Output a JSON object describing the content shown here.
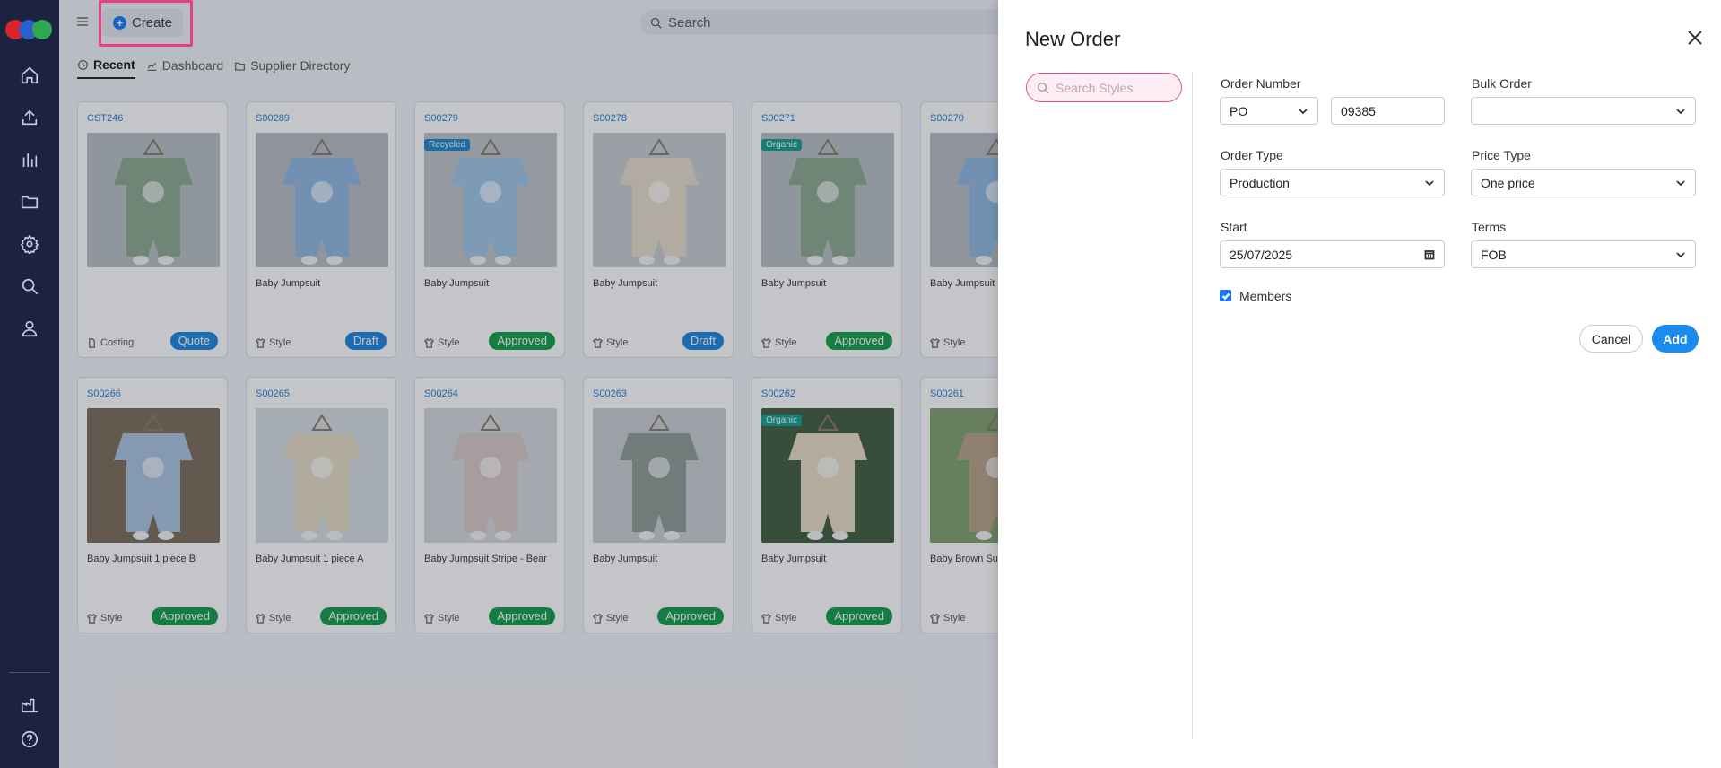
{
  "header": {
    "create_label": "Create",
    "search_placeholder": "Search"
  },
  "tabs": [
    {
      "label": "Recent",
      "icon": "history-icon"
    },
    {
      "label": "Dashboard",
      "icon": "chart-icon"
    },
    {
      "label": "Supplier Directory",
      "icon": "folder-icon"
    }
  ],
  "cards": [
    {
      "code": "CST246",
      "name": "",
      "type": "Costing",
      "status": "Quote",
      "tag": ""
    },
    {
      "code": "S00289",
      "name": "Baby Jumpsuit",
      "type": "Style",
      "status": "Draft",
      "tag": ""
    },
    {
      "code": "S00279",
      "name": "Baby Jumpsuit",
      "type": "Style",
      "status": "Approved",
      "tag": "Recycled"
    },
    {
      "code": "S00278",
      "name": "Baby Jumpsuit",
      "type": "Style",
      "status": "Draft",
      "tag": ""
    },
    {
      "code": "S00271",
      "name": "Baby Jumpsuit",
      "type": "Style",
      "status": "Approved",
      "tag": "Organic"
    },
    {
      "code": "S00270",
      "name": "Baby Jumpsuit",
      "type": "Style",
      "status": "",
      "tag": ""
    },
    {
      "code": "S00266",
      "name": "Baby Jumpsuit 1 piece B",
      "type": "Style",
      "status": "Approved",
      "tag": ""
    },
    {
      "code": "S00265",
      "name": "Baby Jumpsuit 1 piece A",
      "type": "Style",
      "status": "Approved",
      "tag": ""
    },
    {
      "code": "S00264",
      "name": "Baby Jumpsuit Stripe - Bear",
      "type": "Style",
      "status": "Approved",
      "tag": ""
    },
    {
      "code": "S00263",
      "name": "Baby Jumpsuit",
      "type": "Style",
      "status": "Approved",
      "tag": ""
    },
    {
      "code": "S00262",
      "name": "Baby Jumpsuit",
      "type": "Style",
      "status": "Approved",
      "tag": "Organic"
    },
    {
      "code": "S00261",
      "name": "Baby Brown Sui",
      "type": "Style",
      "status": "",
      "tag": ""
    }
  ],
  "drawer": {
    "title": "New Order",
    "search_placeholder": "Search Styles",
    "order_number_label": "Order Number",
    "order_prefix": "PO",
    "order_number": "09385",
    "bulk_order_label": "Bulk Order",
    "bulk_order_value": "",
    "order_type_label": "Order Type",
    "order_type_value": "Production",
    "price_type_label": "Price Type",
    "price_type_value": "One price",
    "start_label": "Start",
    "start_value": "25/07/2025",
    "terms_label": "Terms",
    "terms_value": "FOB",
    "members_label": "Members",
    "cancel_label": "Cancel",
    "add_label": "Add"
  },
  "colors": {
    "sidebar": "#1c2340",
    "accent": "#1677ff",
    "approved": "#0f9a45",
    "highlight": "#e83e8c"
  }
}
